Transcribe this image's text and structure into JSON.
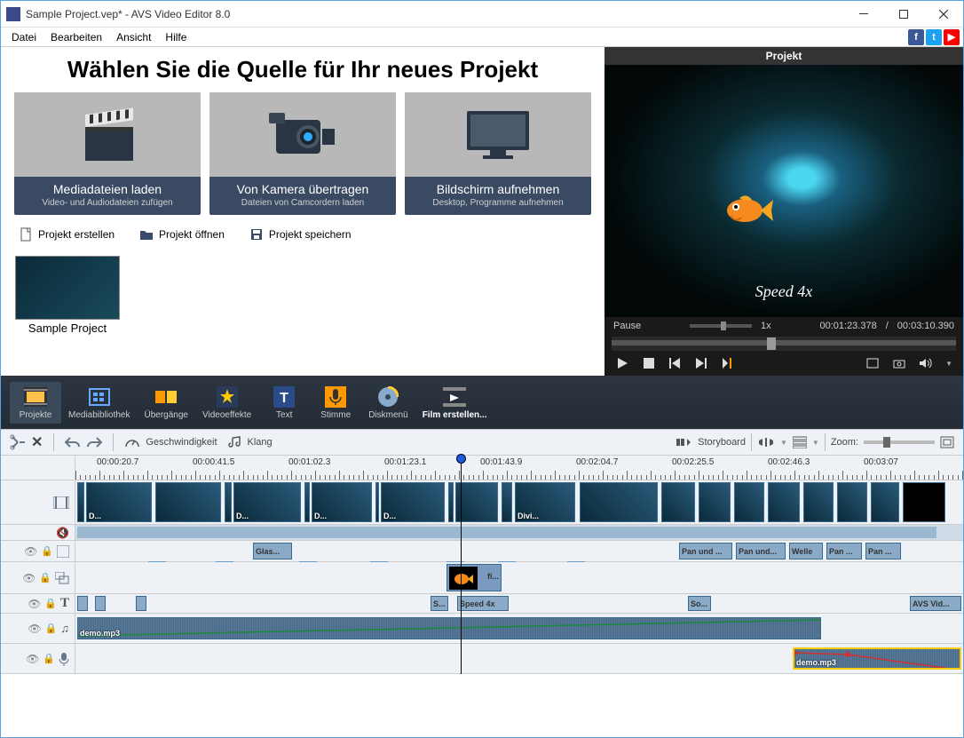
{
  "window": {
    "title": "Sample Project.vep* - AVS Video Editor 8.0"
  },
  "menu": {
    "items": [
      "Datei",
      "Bearbeiten",
      "Ansicht",
      "Hilfe"
    ]
  },
  "headline": "Wählen Sie die Quelle für Ihr neues Projekt",
  "sources": [
    {
      "title": "Mediadateien laden",
      "sub": "Video- und Audiodateien zufügen"
    },
    {
      "title": "Von Kamera übertragen",
      "sub": "Dateien von Camcordern laden"
    },
    {
      "title": "Bildschirm aufnehmen",
      "sub": "Desktop, Programme aufnehmen"
    }
  ],
  "projactions": [
    {
      "label": "Projekt erstellen"
    },
    {
      "label": "Projekt öffnen"
    },
    {
      "label": "Projekt speichern"
    }
  ],
  "thumb": {
    "label": "Sample Project"
  },
  "preview": {
    "header": "Projekt",
    "overlay": "Speed 4x",
    "state": "Pause",
    "speed": "1x",
    "time_current": "00:01:23.378",
    "time_total": "00:03:10.390"
  },
  "maintoolbar": [
    {
      "label": "Projekte",
      "active": true
    },
    {
      "label": "Mediabibliothek"
    },
    {
      "label": "Übergänge"
    },
    {
      "label": "Videoeffekte"
    },
    {
      "label": "Text"
    },
    {
      "label": "Stimme"
    },
    {
      "label": "Diskmenü"
    },
    {
      "label": "Film erstellen..."
    }
  ],
  "secondary": {
    "speed": "Geschwindigkeit",
    "sound": "Klang",
    "storyboard": "Storyboard",
    "zoom": "Zoom:"
  },
  "ruler": [
    "00:00:20.7",
    "00:00:41.5",
    "00:01:02.3",
    "00:01:23.1",
    "00:01:43.9",
    "00:02:04.7",
    "00:02:25.5",
    "00:02:46.3",
    "00:03:07"
  ],
  "clips": {
    "video_labels": [
      "D...",
      "D...",
      "D...",
      "D...",
      "Divi..."
    ],
    "fx": [
      "Glas...",
      "Pan und ...",
      "Pan und...",
      "Welle",
      "Pan ...",
      "Pan ..."
    ],
    "overlay": "fi...",
    "text": [
      "S...",
      "Speed 4x",
      "So...",
      "AVS Vid..."
    ],
    "audio1": "demo.mp3",
    "audio2": "demo.mp3"
  }
}
